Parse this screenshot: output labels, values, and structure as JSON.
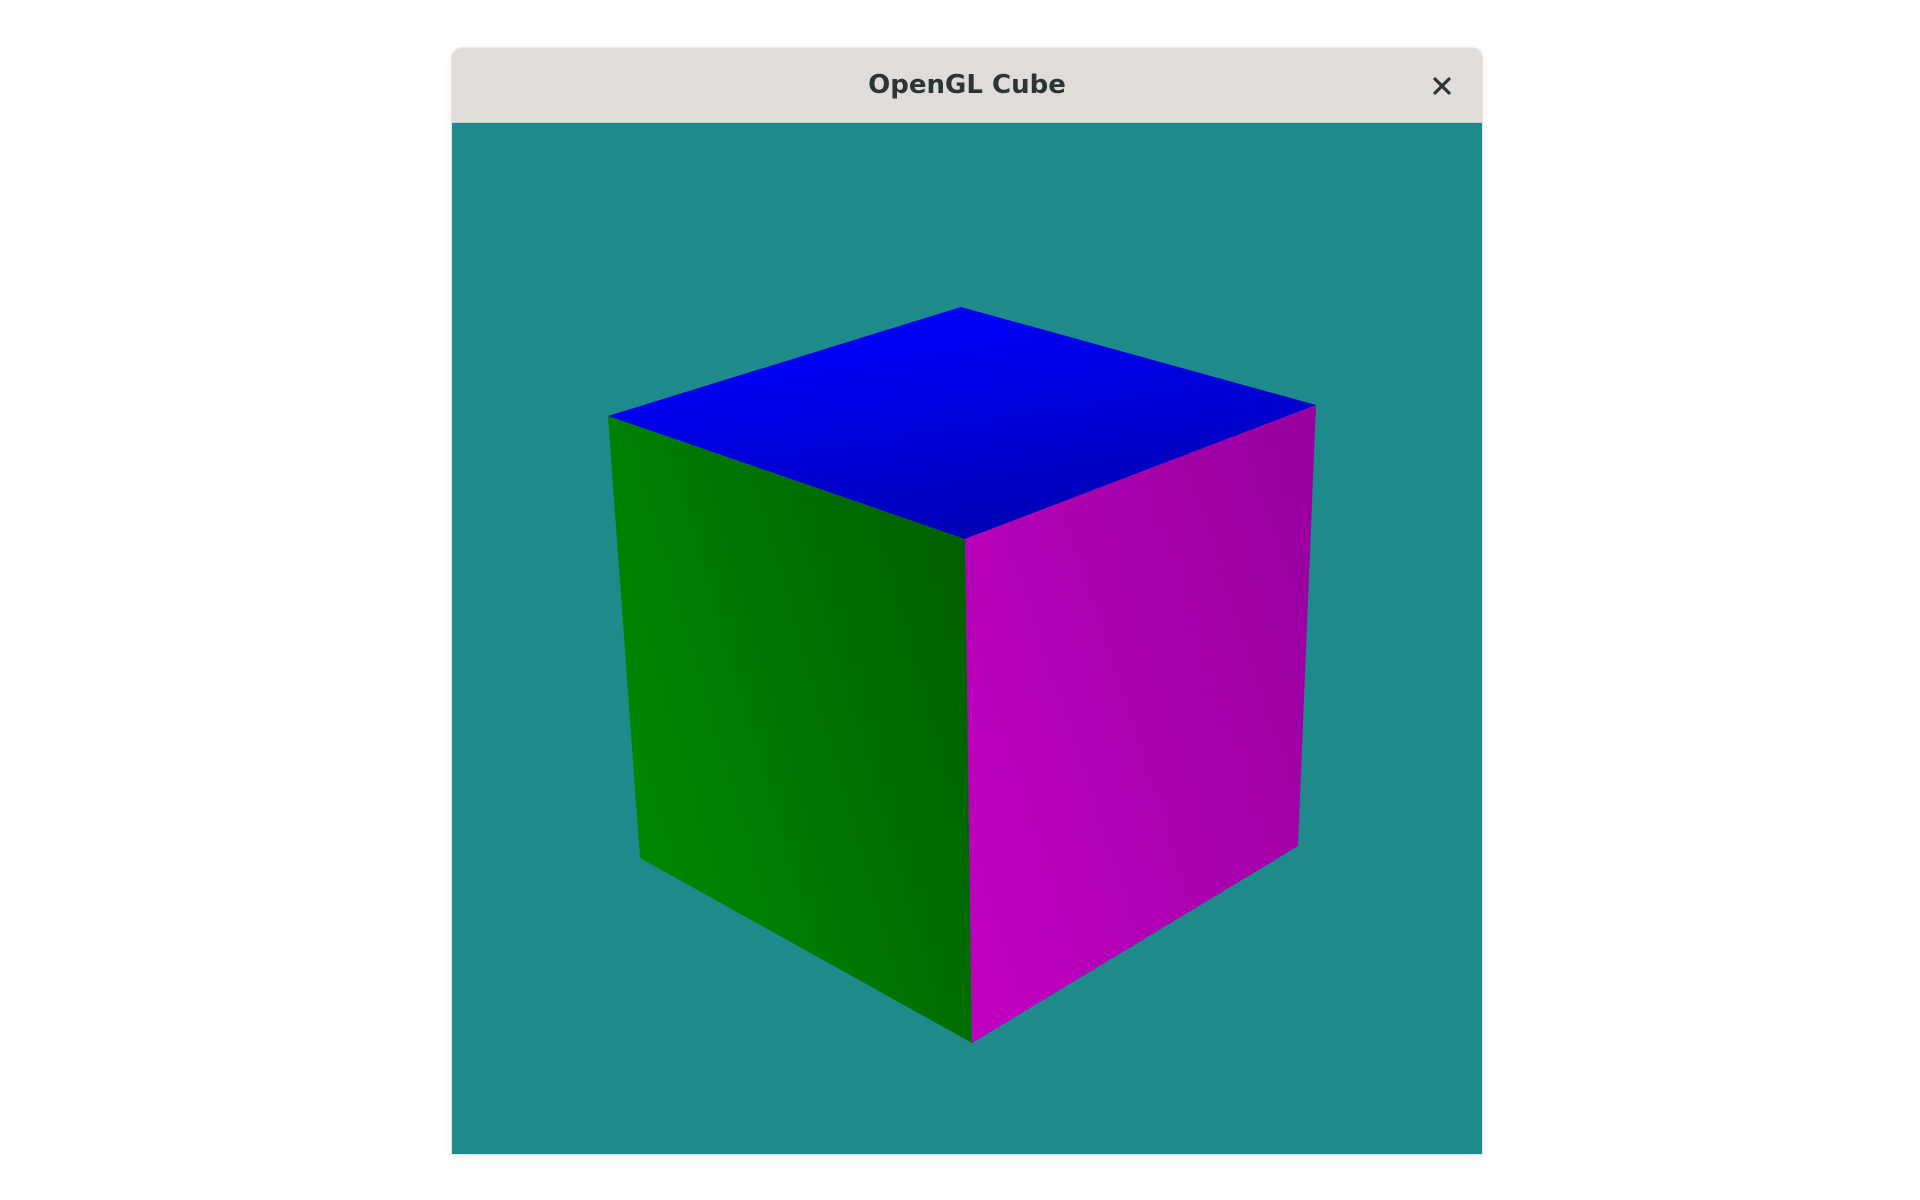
{
  "window": {
    "title": "OpenGL Cube"
  },
  "titlebar": {
    "close_icon": "close-icon"
  },
  "scene": {
    "clear_color": "#1e8a8c",
    "faces": {
      "top": {
        "color": "#0000ff",
        "shade_color": "#0000b4"
      },
      "left": {
        "color": "#009200",
        "shade_color": "#006412"
      },
      "right": {
        "color": "#c800c8",
        "shade_color": "#a000a8"
      }
    }
  }
}
